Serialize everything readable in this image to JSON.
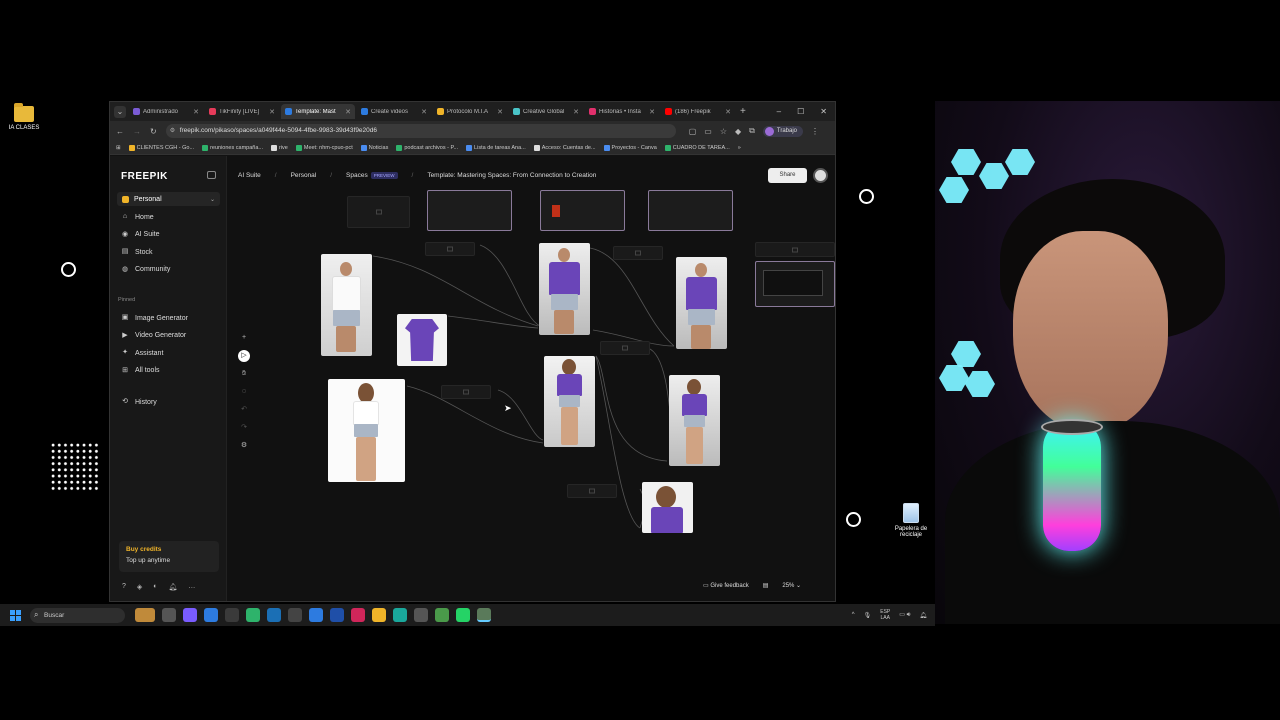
{
  "desktop": {
    "icons": [
      {
        "label": "IA CLASES"
      },
      {
        "label": "Papelera de reciclaje"
      }
    ]
  },
  "browser": {
    "tabs": [
      {
        "label": "Administrado",
        "color": "#7b5cd6"
      },
      {
        "label": "TikFinity [LIVE]",
        "color": "#e63b5a"
      },
      {
        "label": "Template: Mast",
        "color": "#2d7be0",
        "active": true
      },
      {
        "label": "Create videos",
        "color": "#2d7be0"
      },
      {
        "label": "Protocolo M.I.A",
        "color": "#f0b429"
      },
      {
        "label": "Creative Global",
        "color": "#4ac4c8"
      },
      {
        "label": "Historias • Insta",
        "color": "#e1306c"
      },
      {
        "label": "(186) Freepik",
        "color": "#ff0000"
      }
    ],
    "new_tab": "+",
    "window_controls": [
      "–",
      "☐",
      "✕"
    ],
    "url": "freepik.com/pikaso/spaces/a049f44e-5094-4fbe-9983-39d43f9e20d6",
    "profile_label": "Trabajo",
    "bookmarks": [
      {
        "label": "CLIENTES CGH - Go...",
        "color": "#f0b429"
      },
      {
        "label": "reuniones campaña...",
        "color": "#2eb36b"
      },
      {
        "label": "rive",
        "color": "#dddddd"
      },
      {
        "label": "Meet: nhm-cpuo-pct",
        "color": "#2eb36b"
      },
      {
        "label": "Noticias",
        "color": "#4a8cf0"
      },
      {
        "label": "podcast archivos - P...",
        "color": "#2eb36b"
      },
      {
        "label": "Lista de tareas Ana...",
        "color": "#4a8cf0"
      },
      {
        "label": "Acceso: Cuentas de...",
        "color": "#dddddd"
      },
      {
        "label": "Proyectos - Canva",
        "color": "#4a8cf0"
      },
      {
        "label": "CUADRO DE TAREA...",
        "color": "#2eb36b"
      }
    ],
    "bookmarks_more": "»"
  },
  "app": {
    "logo": "FREEPIK",
    "workspace": "Personal",
    "nav_main": [
      {
        "label": "Home",
        "icon": "⌂"
      },
      {
        "label": "AI Suite",
        "icon": "◉"
      },
      {
        "label": "Stock",
        "icon": "▤"
      },
      {
        "label": "Community",
        "icon": "◍"
      }
    ],
    "pinned_heading": "Pinned",
    "nav_pinned": [
      {
        "label": "Image Generator",
        "icon": "▣"
      },
      {
        "label": "Video Generator",
        "icon": "▶"
      },
      {
        "label": "Assistant",
        "icon": "✦"
      },
      {
        "label": "All tools",
        "icon": "⊞"
      }
    ],
    "nav_history": {
      "label": "History",
      "icon": "⟲"
    },
    "credits": {
      "title": "Buy credits",
      "subtitle": "Top up anytime"
    },
    "breadcrumb": {
      "ai_suite": "AI Suite",
      "personal": "Personal",
      "spaces": "Spaces",
      "badge": "PREVIEW",
      "title": "Template: Mastering Spaces: From Connection to Creation"
    },
    "share_label": "Share",
    "feedback_label": "Give feedback",
    "zoom": "25%"
  },
  "taskbar": {
    "search_placeholder": "Buscar",
    "lang_line1": "ESP",
    "lang_line2": "LAA"
  }
}
